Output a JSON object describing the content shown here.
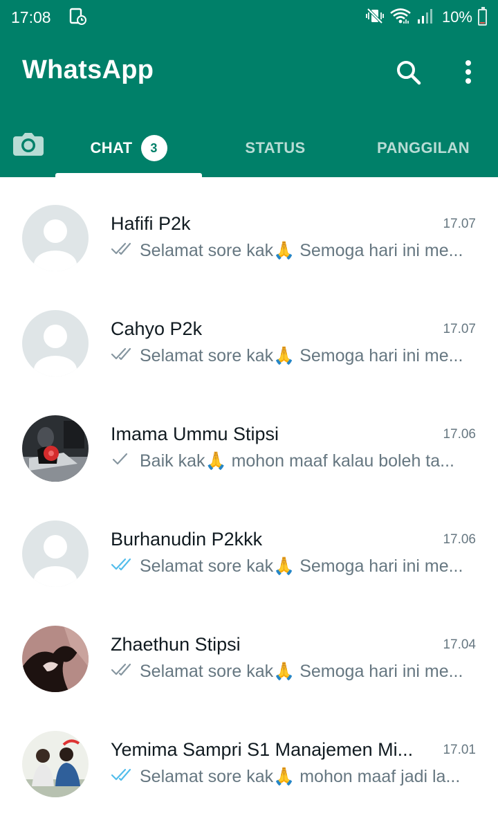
{
  "status_bar": {
    "time": "17:08",
    "battery": "10%",
    "battery_level": 0.1
  },
  "app": {
    "title": "WhatsApp"
  },
  "tabs": {
    "chat_label": "CHAT",
    "chat_badge": "3",
    "status_label": "STATUS",
    "calls_label": "PANGGILAN"
  },
  "colors": {
    "header": "#008069",
    "tick_read": "#53bdeb",
    "tick_delivered": "#8696a0"
  },
  "chats": [
    {
      "name": "Hafifi P2k",
      "time": "17.07",
      "ticks": "double-grey",
      "preview_a": "Selamat sore kak",
      "emoji": "🙏",
      "preview_b": " Semoga hari ini me..."
    },
    {
      "name": "Cahyo P2k",
      "time": "17.07",
      "ticks": "double-grey",
      "preview_a": "Selamat sore kak",
      "emoji": "🙏",
      "preview_b": " Semoga hari ini me..."
    },
    {
      "name": "Imama Ummu Stipsi",
      "time": "17.06",
      "ticks": "single-grey",
      "preview_a": "Baik kak",
      "emoji": "🙏",
      "preview_b": " mohon maaf kalau boleh ta..."
    },
    {
      "name": "Burhanudin P2kkk",
      "time": "17.06",
      "ticks": "double-blue",
      "preview_a": "Selamat sore kak",
      "emoji": "🙏",
      "preview_b": " Semoga hari ini me..."
    },
    {
      "name": "Zhaethun Stipsi",
      "time": "17.04",
      "ticks": "double-grey",
      "preview_a": "Selamat sore kak",
      "emoji": "🙏",
      "preview_b": " Semoga hari ini me..."
    },
    {
      "name": "Yemima Sampri S1 Manajemen Mi...",
      "time": "17.01",
      "ticks": "double-blue",
      "preview_a": "Selamat sore kak",
      "emoji": "🙏",
      "preview_b": " mohon maaf jadi la..."
    }
  ]
}
